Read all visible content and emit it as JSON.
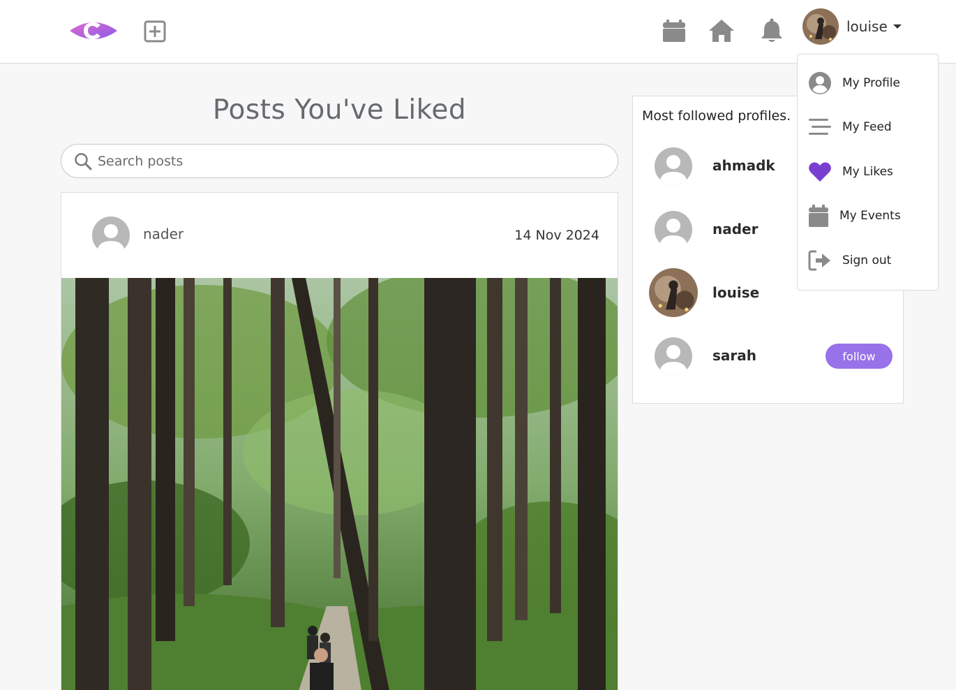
{
  "nav": {
    "username": "louise",
    "logo_icon": "brand-c-eye-logo",
    "icons": [
      "plus-square-icon",
      "calendar-icon",
      "home-icon",
      "bell-icon",
      "caret-down-icon"
    ]
  },
  "dropdown": {
    "items": [
      {
        "label": "My Profile",
        "icon": "user-circle-icon"
      },
      {
        "label": "My Feed",
        "icon": "stream-lines-icon"
      },
      {
        "label": "My Likes",
        "icon": "heart-icon"
      },
      {
        "label": "My Events",
        "icon": "calendar-icon"
      },
      {
        "label": "Sign out",
        "icon": "sign-out-icon"
      }
    ]
  },
  "page": {
    "title": "Posts You've Liked",
    "search_placeholder": "Search posts"
  },
  "post": {
    "author": "nader",
    "date": "14 Nov 2024",
    "image": "forest-hikers-photo"
  },
  "sidebar": {
    "title": "Most followed profiles.",
    "profiles": [
      {
        "name": "ahmadk",
        "avatar": "default-avatar"
      },
      {
        "name": "nader",
        "avatar": "default-avatar"
      },
      {
        "name": "louise",
        "avatar": "photo-avatar"
      },
      {
        "name": "sarah",
        "avatar": "default-avatar",
        "button": "follow"
      }
    ]
  },
  "colors": {
    "accent": "#9872e8",
    "heart": "#7a3fd0",
    "icon_gray": "#8a8a8a",
    "background": "#f7f7f7"
  }
}
